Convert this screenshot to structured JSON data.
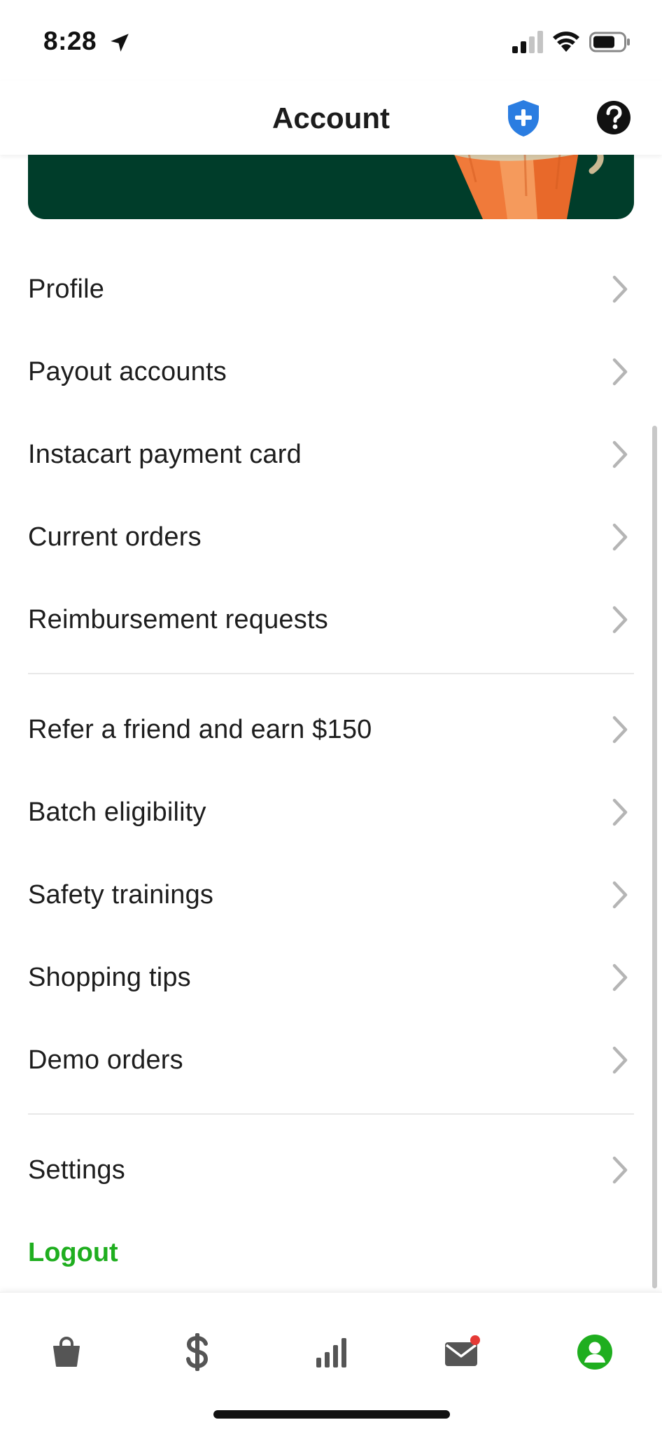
{
  "status_bar": {
    "time": "8:28"
  },
  "header": {
    "title": "Account"
  },
  "menu": {
    "group1": [
      {
        "label": "Profile"
      },
      {
        "label": "Payout accounts"
      },
      {
        "label": "Instacart payment card"
      },
      {
        "label": "Current orders"
      },
      {
        "label": "Reimbursement requests"
      }
    ],
    "group2": [
      {
        "label": "Refer a friend and earn $150"
      },
      {
        "label": "Batch eligibility"
      },
      {
        "label": "Safety trainings"
      },
      {
        "label": "Shopping tips"
      },
      {
        "label": "Demo orders"
      }
    ],
    "group3": [
      {
        "label": "Settings"
      }
    ],
    "logout_label": "Logout"
  },
  "tabbar": {
    "tabs": [
      {
        "icon": "shopping-bag-icon",
        "active": false
      },
      {
        "icon": "dollar-icon",
        "active": false
      },
      {
        "icon": "bar-chart-icon",
        "active": false
      },
      {
        "icon": "mail-icon",
        "active": false,
        "notification_dot": true
      },
      {
        "icon": "account-icon",
        "active": true
      }
    ]
  },
  "colors": {
    "banner": "#003d2a",
    "accent_green": "#1fae1f",
    "shield_blue": "#2b7de1",
    "notification_red": "#e53935",
    "chevron": "#b5b5b5"
  }
}
